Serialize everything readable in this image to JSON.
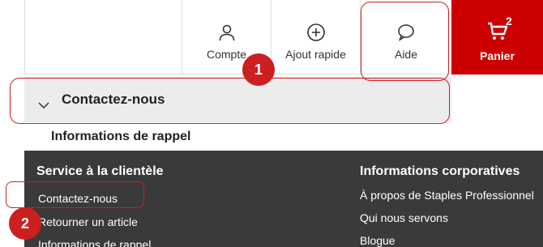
{
  "header": {
    "nav": [
      {
        "label": "Compte",
        "icon": "user-icon"
      },
      {
        "label": "Ajout rapide",
        "icon": "plus-circle-icon"
      },
      {
        "label": "Aide",
        "icon": "chat-bubble-icon"
      }
    ],
    "cart": {
      "label": "Panier",
      "count": "2",
      "icon": "cart-icon"
    }
  },
  "accordion": {
    "title": "Contactez-nous",
    "subtitle": "Informations de rappel"
  },
  "footer": {
    "service": {
      "heading": "Service à la clientèle",
      "links": [
        "Contactez-nous",
        "Retourner un article",
        "Informations de rappel"
      ]
    },
    "corporate": {
      "heading": "Informations corporatives",
      "links": [
        "À propos de Staples Professionnel",
        "Qui nous servons",
        "Blogue"
      ]
    }
  },
  "annotations": {
    "step1": "1",
    "step2": "2"
  },
  "colors": {
    "brand_red": "#cc0000",
    "annotation_red": "#cc1f1f",
    "footer_bg": "#3a3a3a"
  }
}
